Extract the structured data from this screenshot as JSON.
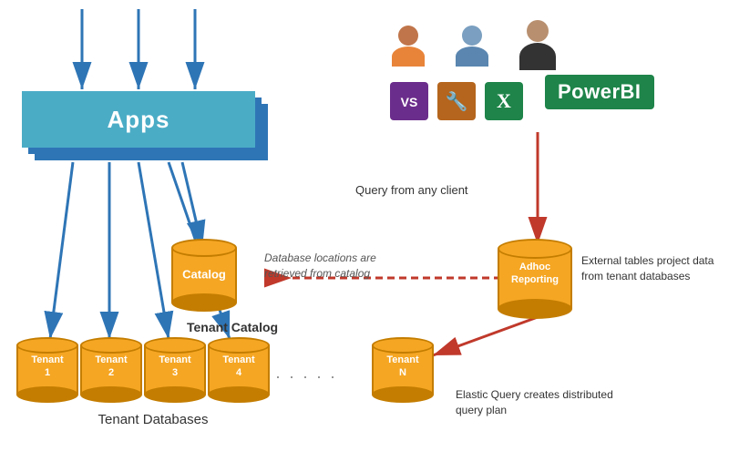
{
  "apps": {
    "label": "Apps"
  },
  "catalog": {
    "label": "Catalog"
  },
  "adhoc": {
    "line1": "Adhoc",
    "line2": "Reporting"
  },
  "tenants": [
    {
      "label": "Tenant\n1"
    },
    {
      "label": "Tenant\n2"
    },
    {
      "label": "Tenant\n3"
    },
    {
      "label": "Tenant\n4"
    },
    {
      "label": "Tenant\nN"
    }
  ],
  "annotations": {
    "query_from_any_client": "Query from any client",
    "database_locations": "Database locations are\nretrieved from catalog",
    "tenant_catalog": "Tenant Catalog",
    "external_tables": "External tables\nproject data from\ntenant databases",
    "elastic_query": "Elastic Query creates\ndistributed query plan",
    "tenant_databases": "Tenant Databases"
  },
  "tools": {
    "vs_label": "VS",
    "tools_label": "⚙",
    "excel_label": "X",
    "powerbi_label": "PowerBI"
  }
}
